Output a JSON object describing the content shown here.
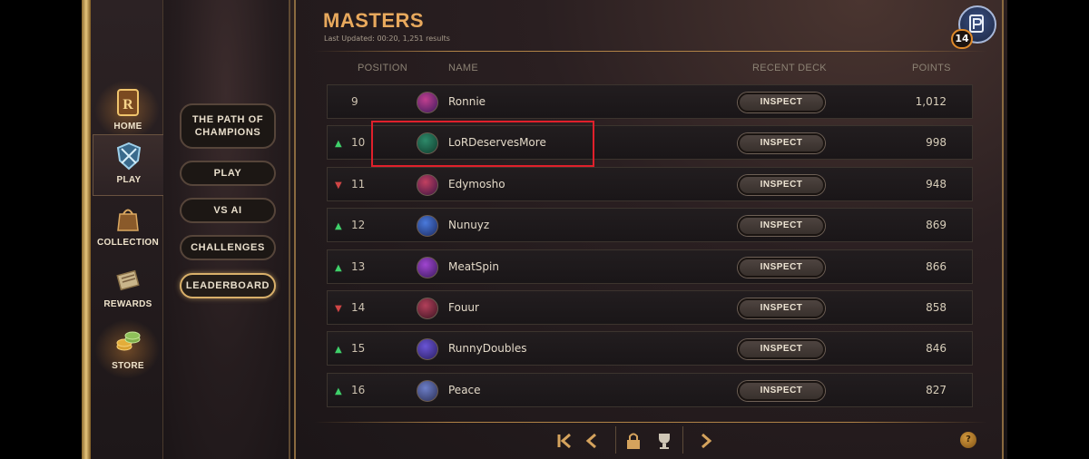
{
  "nav": [
    {
      "label": "HOME",
      "icon": "home-icon"
    },
    {
      "label": "PLAY",
      "icon": "play-shield-icon"
    },
    {
      "label": "COLLECTION",
      "icon": "collection-bag-icon"
    },
    {
      "label": "REWARDS",
      "icon": "rewards-scroll-icon"
    },
    {
      "label": "STORE",
      "icon": "store-coins-icon"
    }
  ],
  "submenu": {
    "path": "THE PATH OF CHAMPIONS",
    "play": "PLAY",
    "vsai": "VS AI",
    "challenges": "CHALLENGES",
    "leaderboard": "LEADERBOARD"
  },
  "header": {
    "title": "MASTERS",
    "subtitle": "Last Updated: 00:20, 1,251 results"
  },
  "columns": {
    "position": "POSITION",
    "name": "NAME",
    "deck": "RECENT DECK",
    "points": "POINTS"
  },
  "rows": [
    {
      "trend": "",
      "position": "9",
      "name": "Ronnie",
      "points": "1,012",
      "inspect": "INSPECT"
    },
    {
      "trend": "up",
      "position": "10",
      "name": "LoRDeservesMore",
      "points": "998",
      "inspect": "INSPECT"
    },
    {
      "trend": "down",
      "position": "11",
      "name": "Edymosho",
      "points": "948",
      "inspect": "INSPECT"
    },
    {
      "trend": "up",
      "position": "12",
      "name": "Nunuyz",
      "points": "869",
      "inspect": "INSPECT"
    },
    {
      "trend": "up",
      "position": "13",
      "name": "MeatSpin",
      "points": "866",
      "inspect": "INSPECT"
    },
    {
      "trend": "down",
      "position": "14",
      "name": "Fouur",
      "points": "858",
      "inspect": "INSPECT"
    },
    {
      "trend": "up",
      "position": "15",
      "name": "RunnyDoubles",
      "points": "846",
      "inspect": "INSPECT"
    },
    {
      "trend": "up",
      "position": "16",
      "name": "Peace",
      "points": "827",
      "inspect": "INSPECT"
    }
  ],
  "profile": {
    "badge": "14"
  },
  "help": "?",
  "colors": {
    "accent": "#e8a95d",
    "gold": "#d9b06a",
    "up": "#3fd06a",
    "down": "#d04545",
    "highlight": "#e0202b"
  }
}
